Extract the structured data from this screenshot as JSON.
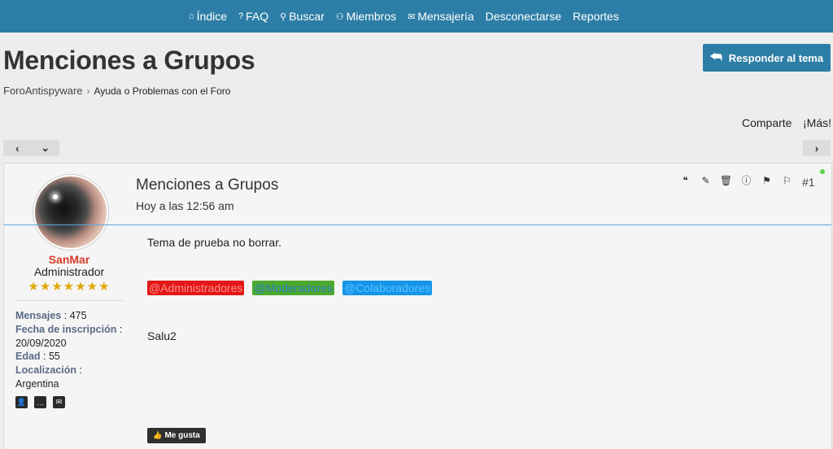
{
  "topnav": [
    {
      "icon": "home-icon",
      "glyph": "⌂",
      "label": "Índice"
    },
    {
      "icon": "question-icon",
      "glyph": "?",
      "label": "FAQ"
    },
    {
      "icon": "search-icon",
      "glyph": "⚲",
      "label": "Buscar"
    },
    {
      "icon": "members-icon",
      "glyph": "⚇",
      "label": "Miembros"
    },
    {
      "icon": "mail-icon",
      "glyph": "✉",
      "label": "Mensajería"
    },
    {
      "icon": "",
      "glyph": "",
      "label": "Desconectarse"
    },
    {
      "icon": "",
      "glyph": "",
      "label": "Reportes"
    }
  ],
  "page": {
    "title": "Menciones a Grupos",
    "reply_label": "Responder al tema",
    "breadcrumb": [
      "ForoAntispyware",
      "Ayuda o Problemas con el Foro"
    ],
    "share_label": "Comparte",
    "more_label": "¡Más!"
  },
  "pager": {
    "prev": "‹",
    "jump": "⌄",
    "next": "›"
  },
  "post": {
    "title": "Menciones a Grupos",
    "date": "Hoy a las 12:56 am",
    "number": "#1",
    "body": "Tema de prueba no borrar.",
    "mentions": [
      "@Administradores",
      "@Moderadores",
      "@Colaboradores"
    ],
    "signoff": "Salu2",
    "like_label": "Me gusta"
  },
  "author": {
    "username": "SanMar",
    "rank": "Administrador",
    "stars": "★★★★★★★",
    "mensajes_label": "Mensajes",
    "mensajes_value": "475",
    "inscripcion_label": "Fecha de inscripción",
    "inscripcion_value": "20/09/2020",
    "edad_label": "Edad",
    "edad_value": "55",
    "localizacion_label": "Localización",
    "localizacion_value": "Argentina"
  },
  "colors": {
    "accent": "#2d7ea6",
    "username": "#d93a27",
    "star": "#e0a800"
  }
}
